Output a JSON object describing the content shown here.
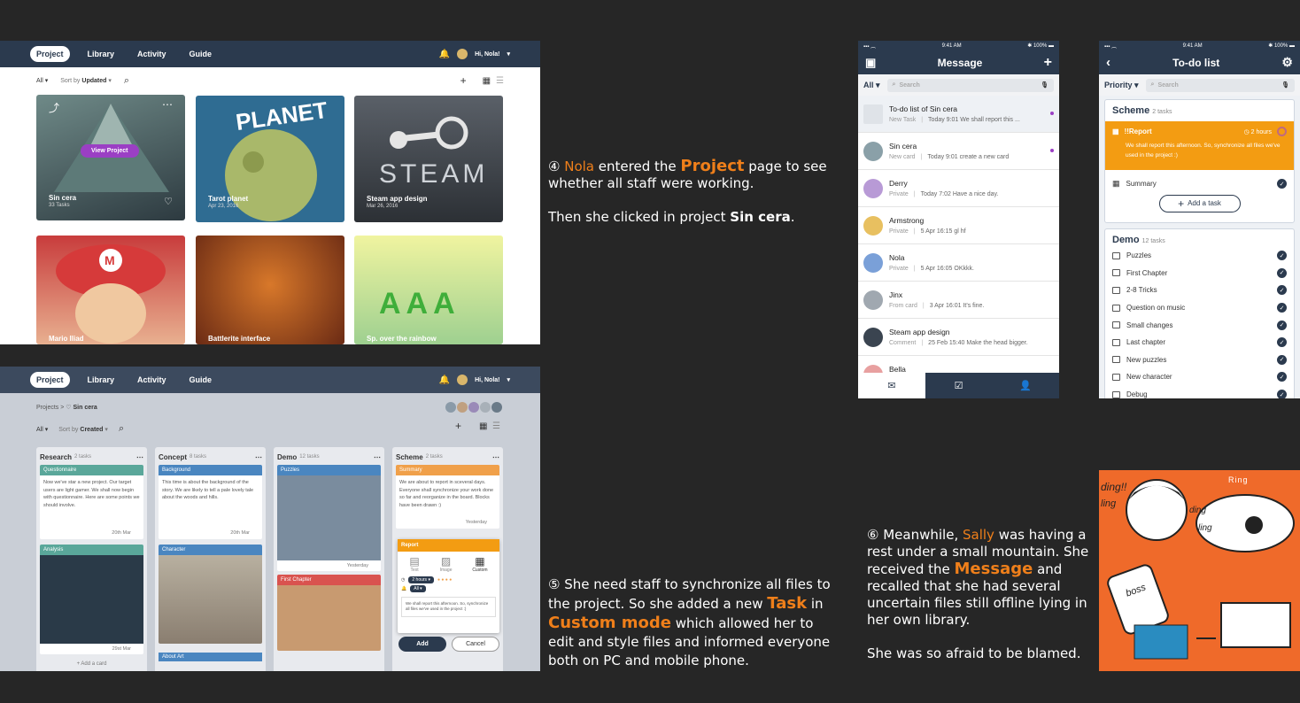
{
  "desktop_nav": {
    "tabs": [
      "Project",
      "Library",
      "Activity",
      "Guide"
    ],
    "greeting": "Hi, Nola!"
  },
  "projects_page": {
    "filter": "All",
    "sort_prefix": "Sort by",
    "sort_value": "Updated",
    "cards": [
      {
        "title": "Sin cera",
        "sub": "33 Tasks",
        "color": "#3f4a55"
      },
      {
        "title": "Tarot planet",
        "sub": "Apr 23, 2016",
        "color": "#2f6c92"
      },
      {
        "title": "Steam app design",
        "sub": "Mar 26, 2016",
        "color": "#4a4f55"
      },
      {
        "title": "Mario Iliad",
        "sub": "",
        "color": "#c83c3c"
      },
      {
        "title": "Battlerite interface",
        "sub": "",
        "color": "#8a3a1e"
      },
      {
        "title": "Sp. over the rainbow",
        "sub": "",
        "color": "#b8d98a"
      }
    ],
    "hover_button": "View Project",
    "ghost_text": "STEAM",
    "tarot_art": "PLANET"
  },
  "board_page": {
    "breadcrumb_root": "Projects",
    "breadcrumb_current": "Sin cera",
    "filter": "All",
    "sort_prefix": "Sort by",
    "sort_value": "Created",
    "columns": [
      {
        "title": "Research",
        "count": "2 tasks",
        "card1": "Questionnaire",
        "card1_color": "#5aa79a",
        "card1_body": "Now we've star a new project. Our target users are light gamer. We shall now begin with questionnaire. Here are some points we should involve.",
        "card1_date": "20th Mar",
        "card2": "Analysis",
        "card2_color": "#5aa79a",
        "foot": "29st Mar",
        "add": "+ Add a card"
      },
      {
        "title": "Concept",
        "count": "8 tasks",
        "card1": "Background",
        "card1_color": "#4a86c0",
        "card1_body": "This time is about the background of the story. We are likely to tell a pale lovely tale about the woods and hills.",
        "card1_date": "20th Mar",
        "card2": "Character",
        "card2_color": "#4a86c0",
        "foot": "",
        "add": "About Art"
      },
      {
        "title": "Demo",
        "count": "12 tasks",
        "card1": "Puzzles",
        "card1_color": "#4a86c0",
        "card1_body": "",
        "card1_date": "Yesterday",
        "card2": "First Chapter",
        "card2_color": "#d9534f",
        "foot": "",
        "add": ""
      },
      {
        "title": "Scheme",
        "count": "2 tasks",
        "card1": "Summary",
        "card1_color": "#f0a04a",
        "card1_body": "We are about to report in sceveral days. Everyone shall synchronize your work done so far and reorganize in the board. Blocks have been drawn :)",
        "card1_date": "Yesterday",
        "card2": "",
        "card2_color": "",
        "foot": "",
        "add": ""
      }
    ],
    "popup": {
      "title": "Report",
      "modes": [
        "Text",
        "Image",
        "Custom"
      ],
      "time": "2 hours",
      "assign": "All",
      "body": "We shall report this afternoon. So, synchronize all files we've used in the project :)",
      "add": "Add",
      "cancel": "Cancel"
    }
  },
  "story": {
    "s4_num": "④",
    "s4_name": "Nola",
    "s4_a": "entered the",
    "s4_page": "Project",
    "s4_b": "page to see whether all staff were working.",
    "s4_c": "Then she clicked in project",
    "s4_proj": "Sin cera",
    "s4_end": ".",
    "s5_num": "⑤",
    "s5_a": "She need staff to synchronize all files to the project. So she added a new",
    "s5_task": "Task",
    "s5_b": "in",
    "s5_mode": "Custom mode",
    "s5_c": "which allowed her to edit and style files and informed everyone both on PC and mobile phone.",
    "s6_num": "⑥",
    "s6_a": "Meanwhile,",
    "s6_name": "Sally",
    "s6_b": "was having a rest under a small mountain. She received the",
    "s6_msg": "Message",
    "s6_c": "and recalled that she had several uncertain files still offline lying in her own library.",
    "s6_d": "She was so afraid to be blamed."
  },
  "phone_status": {
    "time": "9:41 AM",
    "battery": "100%"
  },
  "message_phone": {
    "title": "Message",
    "filter": "All",
    "search_placeholder": "Search",
    "messages": [
      {
        "name": "To-do list of Sin cera",
        "type": "New Task",
        "text": "Today 9:01 We shall report this ...",
        "unread": true,
        "color": "#dfe3e8"
      },
      {
        "name": "Sin cera",
        "type": "New card",
        "text": "Today 9:01 create a new card",
        "unread": true,
        "color": "#8aa0a8"
      },
      {
        "name": "Derry",
        "type": "Private",
        "text": "Today 7:02 Have a nice day.",
        "unread": false,
        "color": "#b89ad6"
      },
      {
        "name": "Armstrong",
        "type": "Private",
        "text": "5 Apr 16:15 gl hf",
        "unread": false,
        "color": "#e8c060"
      },
      {
        "name": "Nola",
        "type": "Private",
        "text": "5 Apr 16:05 OKkkk.",
        "unread": false,
        "color": "#7aa0d8"
      },
      {
        "name": "Jinx",
        "type": "From card",
        "text": "3 Apr 16:01 It's fine.",
        "unread": false,
        "color": "#a0a8b0"
      },
      {
        "name": "Steam app design",
        "type": "Comment",
        "text": "25 Feb 15:40 Make the head bigger.",
        "unread": false,
        "color": "#3a4450"
      },
      {
        "name": "Bella",
        "type": "",
        "text": "",
        "unread": false,
        "color": "#e8a0a0"
      }
    ]
  },
  "todo_phone": {
    "title": "To-do list",
    "filter": "Priority",
    "search_placeholder": "Search",
    "scheme_title": "Scheme",
    "scheme_count": "2 tasks",
    "report_title": "!!Report",
    "report_time": "2 hours",
    "report_body": "We shall report this afternoon. So, synchronize all files we've used in the project :)",
    "summary": "Summary",
    "add_task": "Add a task",
    "demo_title": "Demo",
    "demo_count": "12 tasks",
    "demo_items": [
      "Puzzles",
      "First Chapter",
      "2-8 Tricks",
      "Question on music",
      "Small changes",
      "Last chapter",
      "New puzzles",
      "New character",
      "Debug"
    ]
  },
  "sketch": {
    "texts": [
      "ding!!",
      "ling",
      "ding",
      "ling",
      "boss",
      "Ring"
    ]
  },
  "colors": {
    "navy": "#2b3a4e",
    "orange": "#ef7f1a",
    "purple": "#9b3fc4"
  }
}
